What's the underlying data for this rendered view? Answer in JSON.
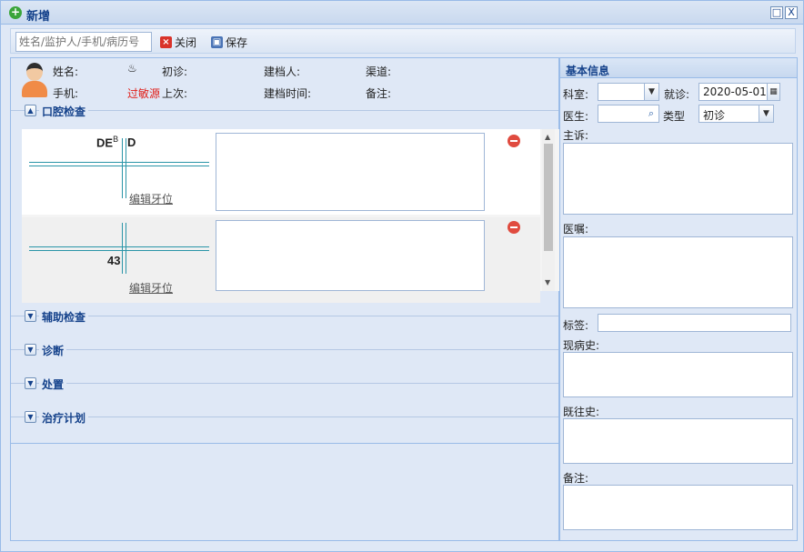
{
  "window": {
    "title": "新增",
    "restore_label": "□",
    "close_label": "X"
  },
  "toolbar": {
    "search_placeholder": "姓名/监护人/手机/病历号",
    "close_label": "关闭",
    "save_label": "保存"
  },
  "patient": {
    "name_label": "姓名:",
    "first_visit_label": "初诊:",
    "creator_label": "建档人:",
    "channel_label": "渠道:",
    "phone_label": "手机:",
    "allergy_label": "过敏源",
    "last_label": "上次:",
    "created_time_label": "建档时间:",
    "remark_label": "备注:"
  },
  "sections": {
    "oral": "口腔检查",
    "aux": "辅助检查",
    "diagnosis": "诊断",
    "treatment": "处置",
    "plan": "治疗计划"
  },
  "exam_rows": [
    {
      "tooth_left": "DE",
      "tooth_sup": "B",
      "tooth_right": "D",
      "edit_label": "编辑牙位"
    },
    {
      "tooth_bottom": "43",
      "edit_label": "编辑牙位"
    }
  ],
  "basic": {
    "title": "基本信息",
    "dept_label": "科室:",
    "visit_label": "就诊:",
    "visit_date": "2020-05-01",
    "doctor_label": "医生:",
    "type_label": "类型",
    "type_value": "初诊",
    "complaint_label": "主诉:",
    "advice_label": "医嘱:",
    "tag_label": "标签:",
    "present_label": "现病史:",
    "past_label": "既往史:",
    "note_label": "备注:"
  },
  "colors": {
    "accent": "#15428b",
    "border": "#99bbe8",
    "panel": "#dfe8f6",
    "allergy": "#e0201a"
  }
}
